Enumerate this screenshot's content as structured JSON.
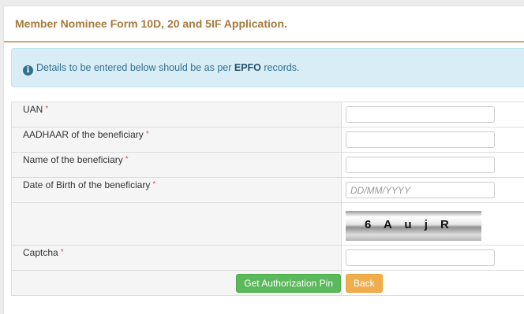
{
  "panel": {
    "title": "Member Nominee Form 10D, 20 and 5IF Application."
  },
  "info": {
    "icon": "info-circle-icon",
    "text_before": "Details to be entered below should be as per ",
    "text_bold": "EPFO",
    "text_after": " records."
  },
  "form": {
    "uan_label": "UAN",
    "aadhaar_label": "AADHAAR of the beneficiary",
    "name_label": "Name of the beneficiary",
    "dob_label": "Date of Birth of the beneficiary",
    "dob_placeholder": "DD/MM/YYYY",
    "captcha_text": "6 A u j  R",
    "captcha_label": "Captcha",
    "required_mark": "*"
  },
  "buttons": {
    "auth_pin_label": "Get Authorization Pin",
    "back_label": "Back"
  },
  "colors": {
    "title": "#a57a3c",
    "info_bg": "#d9edf7",
    "green_button": "#5cb85c",
    "orange_button": "#f0ad4e",
    "required": "#d9534f"
  }
}
